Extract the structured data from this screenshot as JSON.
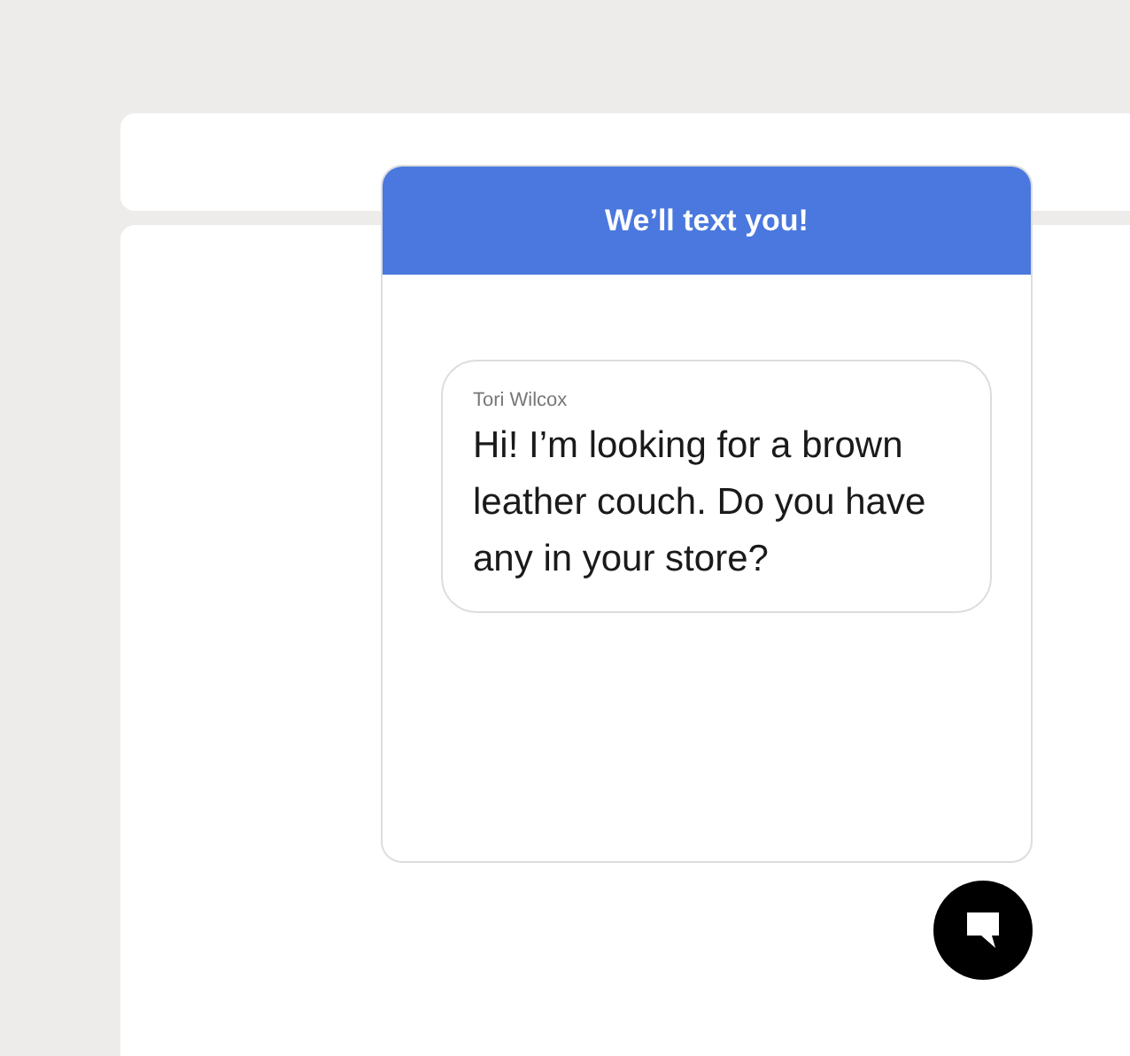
{
  "widget": {
    "title": "We’ll text you!",
    "message": {
      "sender": "Tori Wilcox",
      "text": "Hi! I’m looking for a brown leather couch. Do you have any in your store?"
    }
  }
}
